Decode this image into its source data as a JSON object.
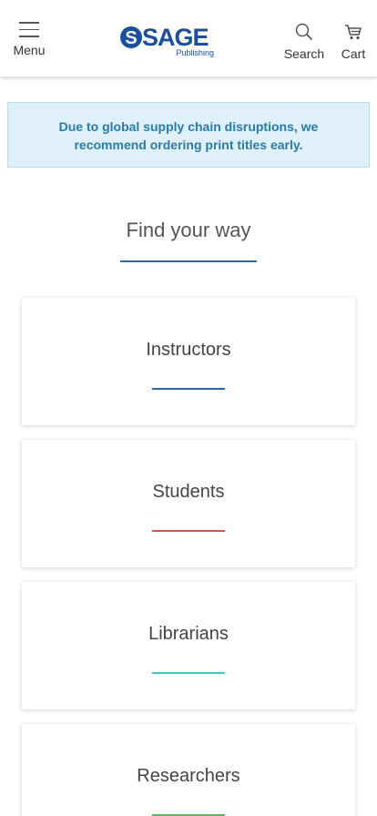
{
  "header": {
    "menu_label": "Menu",
    "logo_main": "SAGE",
    "logo_sub": "Publishing",
    "search_label": "Search",
    "cart_label": "Cart",
    "brand_color": "#1a4fa0"
  },
  "notice": {
    "text": "Due to global supply chain disruptions, we recommend ordering print titles early.",
    "background": "#dff0f8",
    "text_color": "#2a7ba7"
  },
  "find": {
    "title": "Find your way",
    "accent": "#2a6ba7"
  },
  "cards": [
    {
      "label": "Instructors",
      "accent": "#2a6ba7"
    },
    {
      "label": "Students",
      "accent": "#d9534f"
    },
    {
      "label": "Librarians",
      "accent": "#3cc9b8"
    },
    {
      "label": "Researchers",
      "accent": "#5cb85c"
    }
  ],
  "icons": {
    "menu": "hamburger-icon",
    "search": "magnifier-icon",
    "cart": "shopping-cart-icon"
  }
}
